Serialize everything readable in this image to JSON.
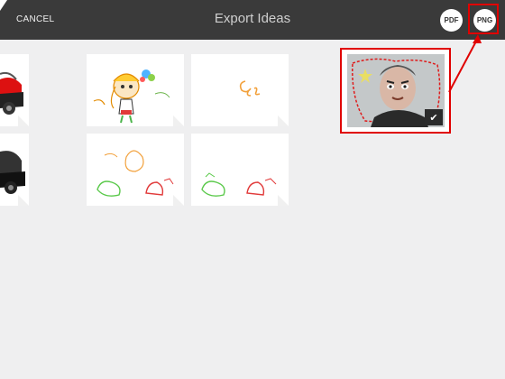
{
  "header": {
    "cancel_label": "CANCEL",
    "title": "Export Ideas",
    "pdf_label": "PDF",
    "png_label": "PNG"
  },
  "grid": {
    "items": [
      {
        "name": "left-red-sketch-top"
      },
      {
        "name": "doodle-character"
      },
      {
        "name": "orange-scribble",
        "text": "Ee"
      },
      {
        "name": "left-black-sketch-bottom"
      },
      {
        "name": "doodle-creatures-1"
      },
      {
        "name": "doodle-creatures-2"
      }
    ]
  },
  "selected": {
    "icon": "checkmark-icon",
    "check_glyph": "✔"
  },
  "colors": {
    "topbar": "#3a3a3a",
    "background": "#efeff0",
    "highlight": "#e00000"
  }
}
